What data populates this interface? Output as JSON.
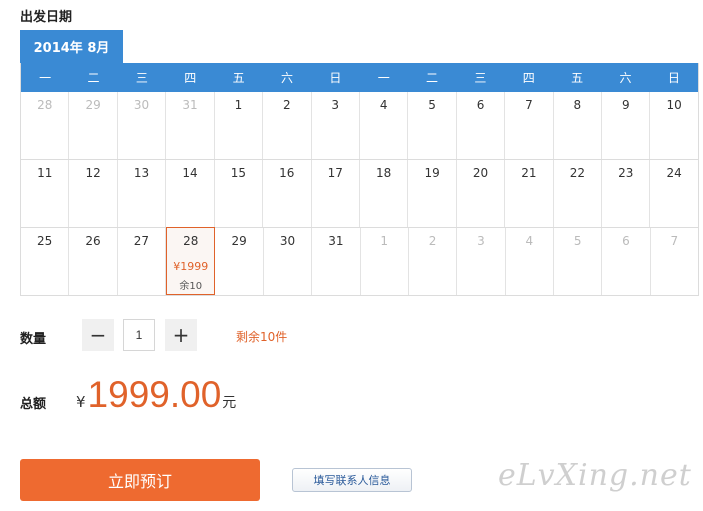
{
  "section_title": "出发日期",
  "month_tab": "2014年 8月",
  "weekdays": [
    "一",
    "二",
    "三",
    "四",
    "五",
    "六",
    "日",
    "一",
    "二",
    "三",
    "四",
    "五",
    "六",
    "日"
  ],
  "weeks": [
    [
      {
        "day": "28",
        "other": true
      },
      {
        "day": "29",
        "other": true
      },
      {
        "day": "30",
        "other": true
      },
      {
        "day": "31",
        "other": true
      },
      {
        "day": "1"
      },
      {
        "day": "2"
      },
      {
        "day": "3"
      },
      {
        "day": "4"
      },
      {
        "day": "5"
      },
      {
        "day": "6"
      },
      {
        "day": "7"
      },
      {
        "day": "8"
      },
      {
        "day": "9"
      },
      {
        "day": "10"
      }
    ],
    [
      {
        "day": "11"
      },
      {
        "day": "12"
      },
      {
        "day": "13"
      },
      {
        "day": "14"
      },
      {
        "day": "15"
      },
      {
        "day": "16"
      },
      {
        "day": "17"
      },
      {
        "day": "18"
      },
      {
        "day": "19"
      },
      {
        "day": "20"
      },
      {
        "day": "21"
      },
      {
        "day": "22"
      },
      {
        "day": "23"
      },
      {
        "day": "24"
      }
    ],
    [
      {
        "day": "25"
      },
      {
        "day": "26"
      },
      {
        "day": "27"
      },
      {
        "day": "28",
        "selected": true,
        "price": "¥1999",
        "stock": "余10"
      },
      {
        "day": "29"
      },
      {
        "day": "30"
      },
      {
        "day": "31"
      },
      {
        "day": "1",
        "other": true
      },
      {
        "day": "2",
        "other": true
      },
      {
        "day": "3",
        "other": true
      },
      {
        "day": "4",
        "other": true
      },
      {
        "day": "5",
        "other": true
      },
      {
        "day": "6",
        "other": true
      },
      {
        "day": "7",
        "other": true
      }
    ]
  ],
  "quantity": {
    "label": "数量",
    "minus": "−",
    "plus": "+",
    "value": "1",
    "remaining": "剩余10件"
  },
  "total": {
    "label": "总额",
    "currency": "¥",
    "amount": "1999.00",
    "unit": "元"
  },
  "actions": {
    "book": "立即预订",
    "contact": "填写联系人信息"
  },
  "watermark": "eLvXing.net",
  "colors": {
    "accent_blue": "#3a8ad4",
    "accent_orange": "#ee6a30",
    "price_orange": "#e0622a"
  }
}
